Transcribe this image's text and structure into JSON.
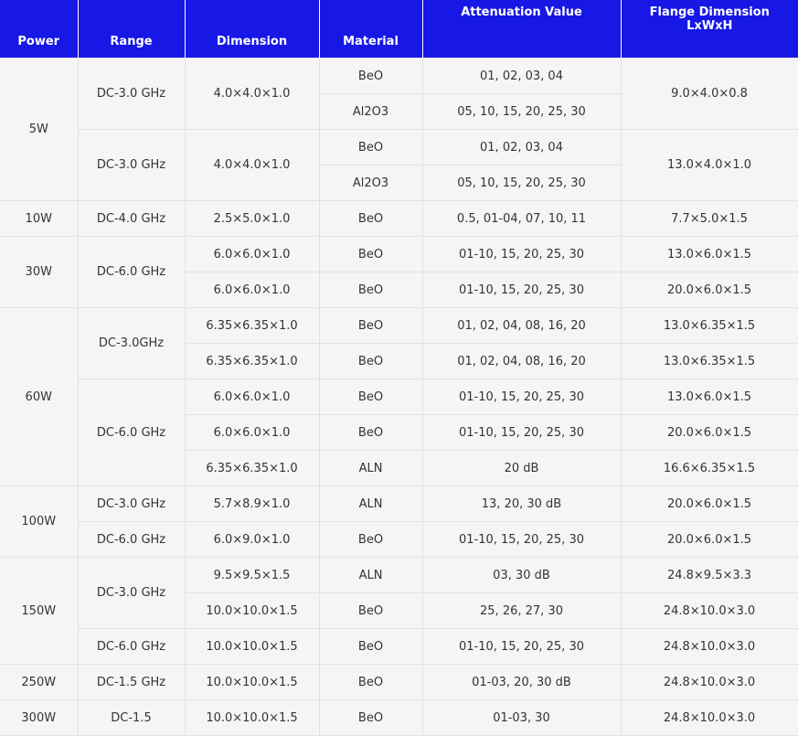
{
  "headers": [
    "Power",
    "Range",
    "Dimension",
    "Material",
    "Attenuation Value",
    "Flange Dimension LxWxH"
  ],
  "rows": [
    [
      "5W",
      "DC-3.0 GHz",
      "4.0×4.0×1.0",
      "BeO",
      "01, 02, 03, 04",
      "9.0×4.0×0.8"
    ],
    [
      "",
      "",
      "",
      "Al2O3",
      "05, 10, 15, 20, 25, 30",
      ""
    ],
    [
      "",
      "DC-3.0 GHz",
      "4.0×4.0×1.0",
      "BeO",
      "01, 02, 03, 04",
      "13.0×4.0×1.0"
    ],
    [
      "",
      "",
      "",
      "Al2O3",
      "05, 10, 15, 20, 25, 30",
      ""
    ],
    [
      "10W",
      "DC-4.0 GHz",
      "2.5×5.0×1.0",
      "BeO",
      "0.5, 01-04, 07, 10, 11",
      "7.7×5.0×1.5"
    ],
    [
      "30W",
      "DC-6.0 GHz",
      "6.0×6.0×1.0",
      "BeO",
      "01-10, 15, 20, 25, 30",
      "13.0×6.0×1.5"
    ],
    [
      "",
      "",
      "6.0×6.0×1.0",
      "BeO",
      "01-10, 15, 20, 25, 30",
      "20.0×6.0×1.5"
    ],
    [
      "60W",
      "DC-3.0GHz",
      "6.35×6.35×1.0",
      "BeO",
      "01, 02, 04, 08, 16, 20",
      "13.0×6.35×1.5"
    ],
    [
      "",
      "",
      "6.35×6.35×1.0",
      "BeO",
      "01, 02, 04, 08, 16, 20",
      "13.0×6.35×1.5"
    ],
    [
      "",
      "DC-6.0 GHz",
      "6.0×6.0×1.0",
      "BeO",
      "01-10, 15, 20, 25, 30",
      "13.0×6.0×1.5"
    ],
    [
      "",
      "",
      "6.0×6.0×1.0",
      "BeO",
      "01-10, 15, 20, 25, 30",
      "20.0×6.0×1.5"
    ],
    [
      "",
      "",
      "6.35×6.35×1.0",
      "ALN",
      "20 dB",
      "16.6×6.35×1.5"
    ],
    [
      "100W",
      "DC-3.0 GHz",
      "5.7×8.9×1.0",
      "ALN",
      "13, 20, 30 dB",
      "20.0×6.0×1.5"
    ],
    [
      "",
      "DC-6.0 GHz",
      "6.0×9.0×1.0",
      "BeO",
      "01-10, 15, 20, 25, 30",
      "20.0×6.0×1.5"
    ],
    [
      "150W",
      "DC-3.0 GHz",
      "9.5×9.5×1.5",
      "ALN",
      "03, 30 dB",
      "24.8×9.5×3.3"
    ],
    [
      "",
      "",
      "10.0×10.0×1.5",
      "BeO",
      "25, 26, 27, 30",
      "24.8×10.0×3.0"
    ],
    [
      "",
      "DC-6.0 GHz",
      "10.0×10.0×1.5",
      "BeO",
      "01-10, 15, 20, 25, 30",
      "24.8×10.0×3.0"
    ],
    [
      "250W",
      "DC-1.5 GHz",
      "10.0×10.0×1.5",
      "BeO",
      "01-03, 20, 30 dB",
      "24.8×10.0×3.0"
    ],
    [
      "300W",
      "DC-1.5",
      "10.0×10.0×1.5",
      "BeO",
      "01-03, 30",
      "24.8×10.0×3.0"
    ]
  ]
}
